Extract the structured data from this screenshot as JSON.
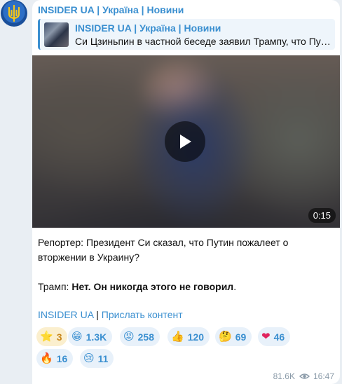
{
  "channel": {
    "name": "INSIDER UA | Україна | Новини"
  },
  "reply": {
    "title": "INSIDER UA | Україна | Новини",
    "text": "Си Цзиньпин в частной беседе заявил Трампу, что Путин пожалеет о вторжении в Украину"
  },
  "video": {
    "duration": "0:15"
  },
  "message": {
    "line1": "Репортер: Президент Си сказал, что Путин пожалеет о вторжении в Украину?",
    "line2_prefix": "Трамп: ",
    "line2_bold": "Нет. Он никогда этого не говорил",
    "line2_suffix": "."
  },
  "links": {
    "link1": "INSIDER UA",
    "separator": " | ",
    "link2": "Прислать контент"
  },
  "reactions": [
    {
      "emoji": "⭐",
      "count": "3",
      "icon": "star-icon"
    },
    {
      "emoji": "😁",
      "count": "1.3K",
      "icon": "grin-icon"
    },
    {
      "emoji": "😡",
      "count": "258",
      "icon": "angry-icon"
    },
    {
      "emoji": "👍",
      "count": "120",
      "icon": "thumbs-up-icon"
    },
    {
      "emoji": "🤔",
      "count": "69",
      "icon": "thinking-icon"
    },
    {
      "emoji": "❤",
      "count": "46",
      "icon": "heart-icon"
    },
    {
      "emoji": "🔥",
      "count": "16",
      "icon": "fire-icon"
    },
    {
      "emoji": "😢",
      "count": "11",
      "icon": "cry-icon"
    }
  ],
  "meta": {
    "views": "81.6K",
    "time": "16:47"
  },
  "colors": {
    "accent": "#3a8fd0",
    "background": "#e9eef3",
    "bubble": "#ffffff",
    "paid_reaction": "#fbefce"
  }
}
